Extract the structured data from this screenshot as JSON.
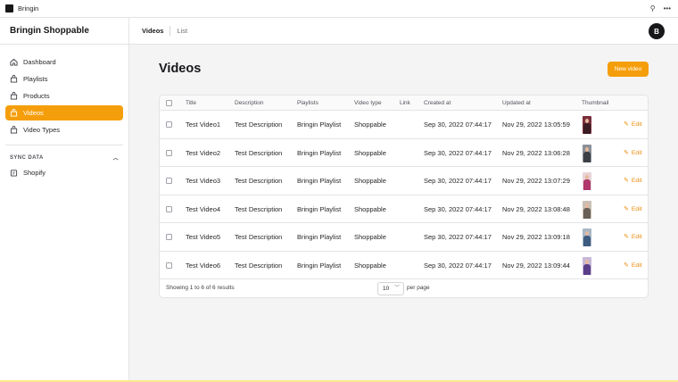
{
  "window": {
    "title": "Bringin",
    "pin_icon": "pin-icon",
    "more_icon": "more-icon"
  },
  "brand": "Bringin Shoppable",
  "nav": [
    {
      "label": "Dashboard",
      "icon": "home-icon"
    },
    {
      "label": "Playlists",
      "icon": "bag-icon"
    },
    {
      "label": "Products",
      "icon": "bag-icon"
    },
    {
      "label": "Videos",
      "icon": "bag-icon",
      "active": true
    },
    {
      "label": "Video Types",
      "icon": "bag-icon"
    }
  ],
  "sync": {
    "title": "SYNC DATA",
    "items": [
      {
        "label": "Shopify",
        "icon": "shopify-icon"
      }
    ]
  },
  "breadcrumb": {
    "current": "Videos",
    "next": "List"
  },
  "user": {
    "initial": "B"
  },
  "page": {
    "title": "Videos",
    "new_button": "New video"
  },
  "table": {
    "columns": [
      "Title",
      "Description",
      "Playlists",
      "Video type",
      "Link",
      "Created at",
      "Updated at",
      "Thumbnail"
    ],
    "edit_label": "Edit",
    "rows": [
      {
        "title": "Test Video1",
        "description": "Test Description",
        "playlist": "Bringin Playlist",
        "type": "Shoppable",
        "created": "Sep 30, 2022 07:44:17",
        "updated": "Nov 29, 2022 13:05:59"
      },
      {
        "title": "Test Video2",
        "description": "Test Description",
        "playlist": "Bringin Playlist",
        "type": "Shoppable",
        "created": "Sep 30, 2022 07:44:17",
        "updated": "Nov 29, 2022 13:06:28"
      },
      {
        "title": "Test Video3",
        "description": "Test Description",
        "playlist": "Bringin Playlist",
        "type": "Shoppable",
        "created": "Sep 30, 2022 07:44:17",
        "updated": "Nov 29, 2022 13:07:29"
      },
      {
        "title": "Test Video4",
        "description": "Test Description",
        "playlist": "Bringin Playlist",
        "type": "Shoppable",
        "created": "Sep 30, 2022 07:44:17",
        "updated": "Nov 29, 2022 13:08:48"
      },
      {
        "title": "Test Video5",
        "description": "Test Description",
        "playlist": "Bringin Playlist",
        "type": "Shoppable",
        "created": "Sep 30, 2022 07:44:17",
        "updated": "Nov 29, 2022 13:09:18"
      },
      {
        "title": "Test Video6",
        "description": "Test Description",
        "playlist": "Bringin Playlist",
        "type": "Shoppable",
        "created": "Sep 30, 2022 07:44:17",
        "updated": "Nov 29, 2022 13:09:44"
      }
    ]
  },
  "pagination": {
    "summary": "Showing 1 to 6 of 6 results",
    "per_page_value": "10",
    "per_page_label": "per page"
  },
  "colors": {
    "accent": "#f59e0b",
    "edit": "#ea8c0c",
    "thumbnails": [
      "#7a2e3a",
      "#5a5f6b",
      "#b0386b",
      "#6b6058",
      "#3e5c80",
      "#5a3e8a"
    ]
  }
}
